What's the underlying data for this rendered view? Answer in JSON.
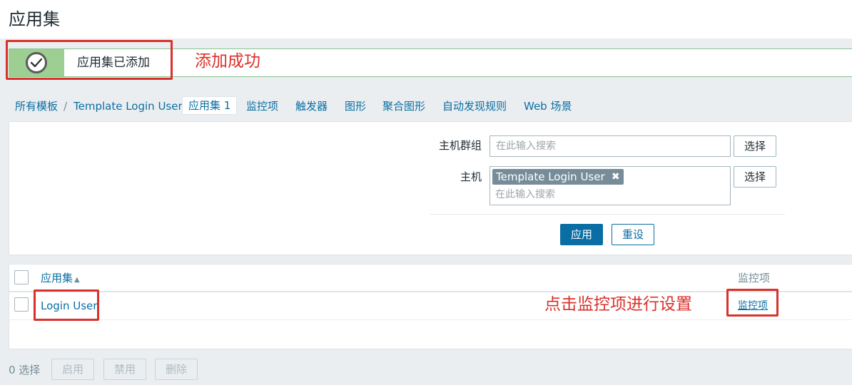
{
  "page": {
    "title": "应用集"
  },
  "message": {
    "text": "应用集已添加",
    "icon": "check-circle-icon"
  },
  "annotations": {
    "added_success": "添加成功",
    "click_items_hint": "点击监控项进行设置",
    "color": "#d9312b"
  },
  "nav": {
    "breadcrumb_all": "所有模板",
    "separator": "/",
    "template_name": "Template Login User",
    "tabs": [
      {
        "label": "应用集 1"
      },
      {
        "label": "监控项"
      },
      {
        "label": "触发器"
      },
      {
        "label": "图形"
      },
      {
        "label": "聚合图形"
      },
      {
        "label": "自动发现规则"
      },
      {
        "label": "Web 场景"
      }
    ]
  },
  "filter": {
    "host_group_label": "主机群组",
    "host_group_placeholder": "在此输入搜索",
    "host_label": "主机",
    "host_chip": "Template Login User",
    "host_placeholder": "在此输入搜索",
    "select_label": "选择",
    "apply_label": "应用",
    "reset_label": "重设"
  },
  "table": {
    "col_application": "应用集",
    "col_items": "监控项",
    "rows": [
      {
        "name": "Login User",
        "items_link": "监控项"
      }
    ]
  },
  "footer": {
    "selected": "0 选择",
    "enable": "启用",
    "disable": "禁用",
    "delete": "删除"
  },
  "colors": {
    "link": "#0a6ea4",
    "success_green": "#9ccf91",
    "primary_button": "#0a6ea4"
  }
}
